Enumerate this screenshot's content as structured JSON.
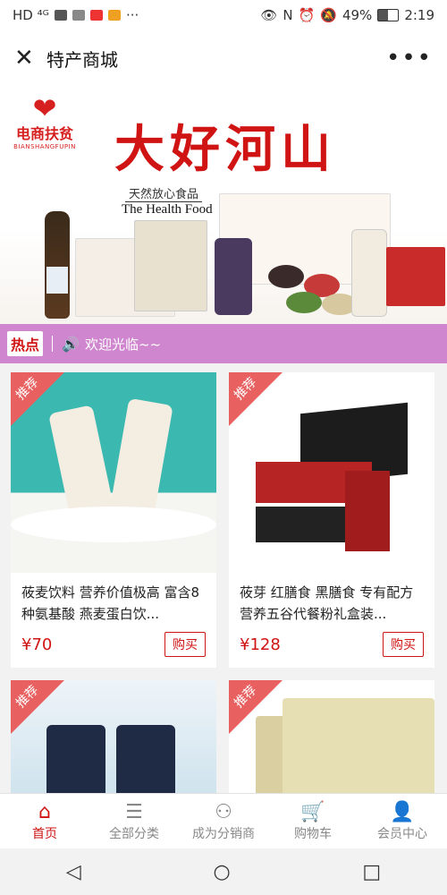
{
  "status_bar": {
    "left_text": "HD ⁴ᴳ",
    "battery": "49%",
    "time": "2:19",
    "extra": "···"
  },
  "header": {
    "title": "特产商城",
    "close_icon": "close-icon",
    "more_icon": "more-icon"
  },
  "banner": {
    "logo_text": "电商扶贫",
    "logo_subtext": "BIANSHANGFUPIN",
    "headline": "大好河山",
    "slogan_cn": "天然放心食品",
    "slogan_en": "The Health Food"
  },
  "hotbar": {
    "label": "热点",
    "message": "欢迎光临~~"
  },
  "products": [
    {
      "badge": "推荐",
      "title": "莜麦饮料 营养价值极高 富含8种氨基酸 燕麦蛋白饮...",
      "price": "¥70",
      "buy_label": "购买"
    },
    {
      "badge": "推荐",
      "title": "莜芽 红膳食 黑膳食 专有配方营养五谷代餐粉礼盒装...",
      "price": "¥128",
      "buy_label": "购买"
    },
    {
      "badge": "推荐"
    },
    {
      "badge": "推荐"
    }
  ],
  "tabbar": {
    "tabs": [
      {
        "label": "首页",
        "icon": "home-icon"
      },
      {
        "label": "全部分类",
        "icon": "category-icon"
      },
      {
        "label": "成为分销商",
        "icon": "users-icon"
      },
      {
        "label": "购物车",
        "icon": "cart-icon"
      },
      {
        "label": "会员中心",
        "icon": "user-icon"
      }
    ]
  },
  "colors": {
    "accent": "#d01414",
    "hotbar": "#cf86cf",
    "badge": "#e86060"
  }
}
